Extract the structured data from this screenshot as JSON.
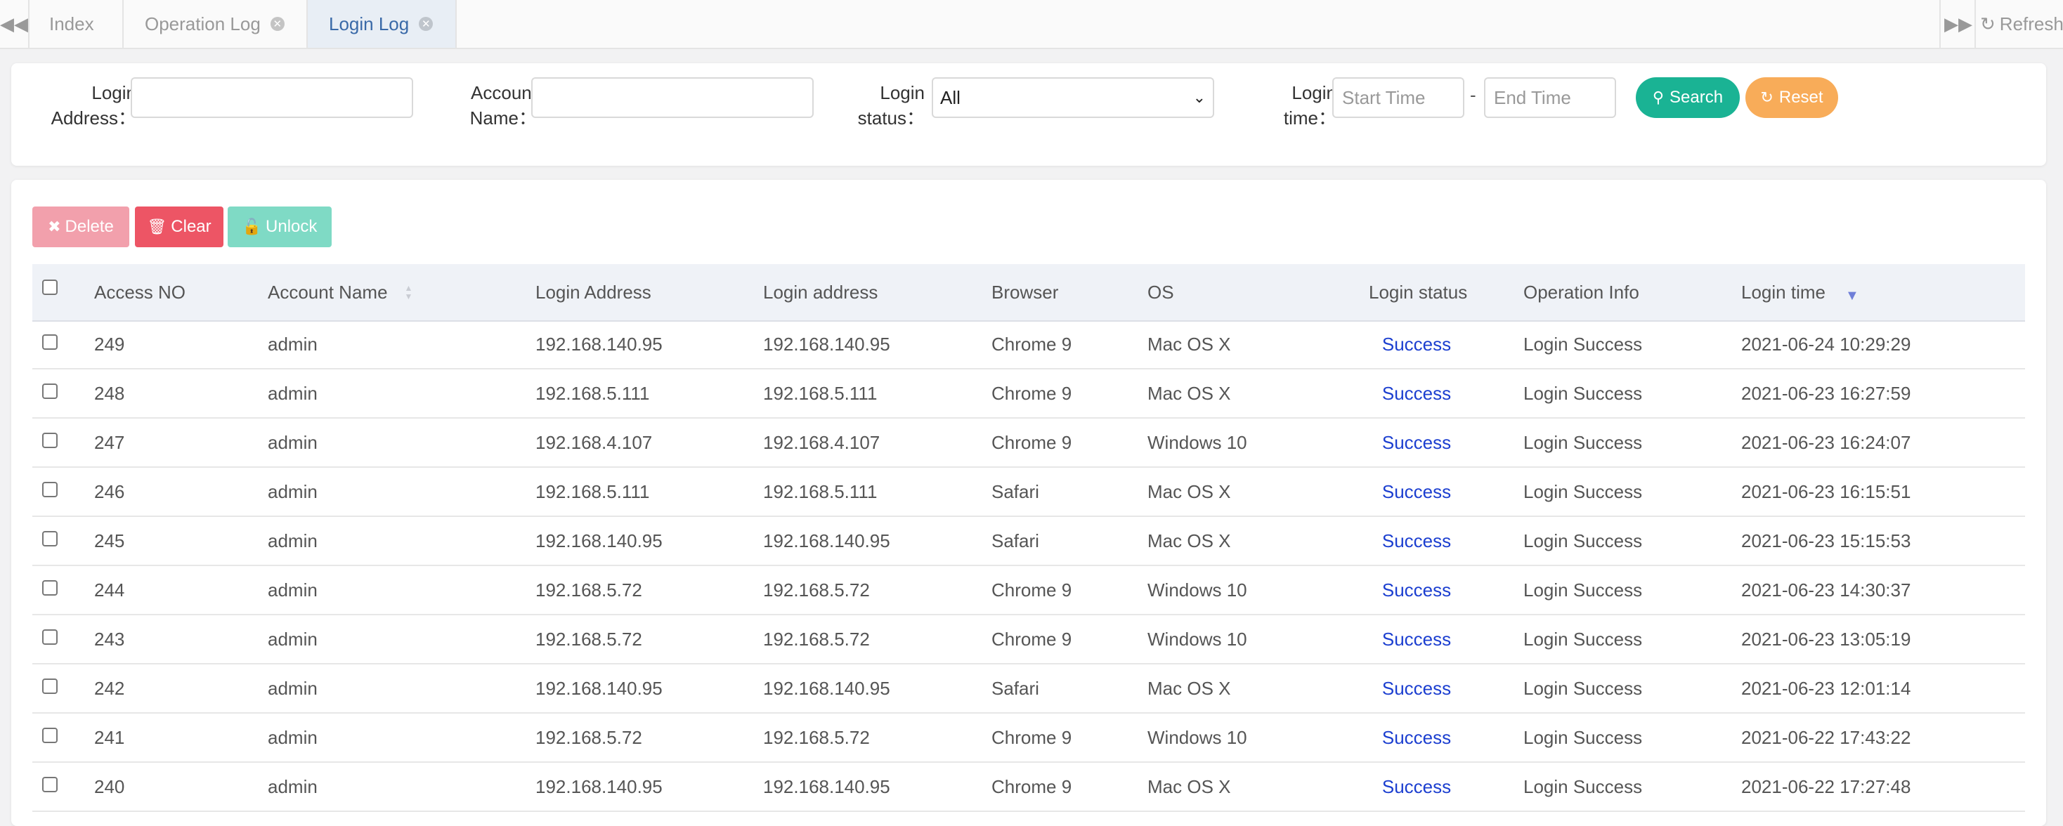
{
  "tabs": {
    "items": [
      {
        "label": "Index",
        "closable": false,
        "active": false
      },
      {
        "label": "Operation Log",
        "closable": true,
        "active": false
      },
      {
        "label": "Login Log",
        "closable": true,
        "active": true
      }
    ],
    "refresh_label": "Refresh",
    "icons": {
      "prev": "double-chevron-left-icon",
      "next": "double-chevron-right-icon",
      "refresh": "refresh-icon",
      "close": "close-circle-icon"
    }
  },
  "search": {
    "login_address": {
      "label_line1": "Login",
      "label_line2": "Address：",
      "value": ""
    },
    "account_name": {
      "label_line1": "Account",
      "label_line2": "Name：",
      "value": ""
    },
    "login_status": {
      "label_line1": "Login",
      "label_line2": "status：",
      "selected": "All"
    },
    "login_time": {
      "label_line1": "Login",
      "label_line2": "time：",
      "start_placeholder": "Start Time",
      "end_placeholder": "End Time",
      "separator": "-"
    },
    "search_label": "Search",
    "reset_label": "Reset",
    "colors": {
      "search": "#1ab394",
      "reset": "#f8ac59"
    }
  },
  "toolbar": {
    "delete_label": "Delete",
    "clear_label": "Clear",
    "unlock_label": "Unlock",
    "colors": {
      "delete": "#f2a0ac",
      "clear": "#ed5565",
      "unlock": "#7fdac5"
    }
  },
  "table": {
    "columns": [
      "Access NO",
      "Account Name",
      "Login Address",
      "Login address",
      "Browser",
      "OS",
      "Login status",
      "Operation Info",
      "Login time"
    ],
    "status_color": "#1c3fd0",
    "rows": [
      {
        "no": "249",
        "account": "admin",
        "address": "192.168.140.95",
        "location": "192.168.140.95",
        "browser": "Chrome 9",
        "os": "Mac OS X",
        "status": "Success",
        "info": "Login Success",
        "time": "2021-06-24 10:29:29"
      },
      {
        "no": "248",
        "account": "admin",
        "address": "192.168.5.111",
        "location": "192.168.5.111",
        "browser": "Chrome 9",
        "os": "Mac OS X",
        "status": "Success",
        "info": "Login Success",
        "time": "2021-06-23 16:27:59"
      },
      {
        "no": "247",
        "account": "admin",
        "address": "192.168.4.107",
        "location": "192.168.4.107",
        "browser": "Chrome 9",
        "os": "Windows 10",
        "status": "Success",
        "info": "Login Success",
        "time": "2021-06-23 16:24:07"
      },
      {
        "no": "246",
        "account": "admin",
        "address": "192.168.5.111",
        "location": "192.168.5.111",
        "browser": "Safari",
        "os": "Mac OS X",
        "status": "Success",
        "info": "Login Success",
        "time": "2021-06-23 16:15:51"
      },
      {
        "no": "245",
        "account": "admin",
        "address": "192.168.140.95",
        "location": "192.168.140.95",
        "browser": "Safari",
        "os": "Mac OS X",
        "status": "Success",
        "info": "Login Success",
        "time": "2021-06-23 15:15:53"
      },
      {
        "no": "244",
        "account": "admin",
        "address": "192.168.5.72",
        "location": "192.168.5.72",
        "browser": "Chrome 9",
        "os": "Windows 10",
        "status": "Success",
        "info": "Login Success",
        "time": "2021-06-23 14:30:37"
      },
      {
        "no": "243",
        "account": "admin",
        "address": "192.168.5.72",
        "location": "192.168.5.72",
        "browser": "Chrome 9",
        "os": "Windows 10",
        "status": "Success",
        "info": "Login Success",
        "time": "2021-06-23 13:05:19"
      },
      {
        "no": "242",
        "account": "admin",
        "address": "192.168.140.95",
        "location": "192.168.140.95",
        "browser": "Safari",
        "os": "Mac OS X",
        "status": "Success",
        "info": "Login Success",
        "time": "2021-06-23 12:01:14"
      },
      {
        "no": "241",
        "account": "admin",
        "address": "192.168.5.72",
        "location": "192.168.5.72",
        "browser": "Chrome 9",
        "os": "Windows 10",
        "status": "Success",
        "info": "Login Success",
        "time": "2021-06-22 17:43:22"
      },
      {
        "no": "240",
        "account": "admin",
        "address": "192.168.140.95",
        "location": "192.168.140.95",
        "browser": "Chrome 9",
        "os": "Mac OS X",
        "status": "Success",
        "info": "Login Success",
        "time": "2021-06-22 17:27:48"
      }
    ]
  }
}
